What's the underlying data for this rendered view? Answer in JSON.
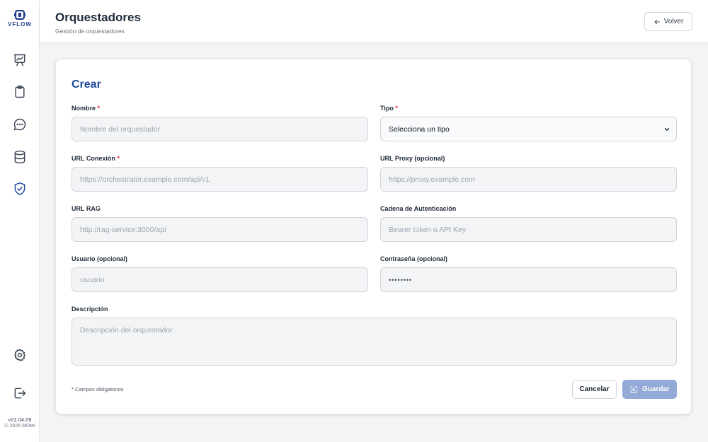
{
  "sidebar": {
    "logo_text": "VFLOW",
    "nav": [
      {
        "icon": "presentation-chart-icon"
      },
      {
        "icon": "clipboard-icon"
      },
      {
        "icon": "chat-bubble-icon"
      },
      {
        "icon": "database-icon"
      },
      {
        "icon": "shield-check-icon",
        "active": true
      }
    ],
    "bottom": [
      {
        "icon": "gear-icon"
      },
      {
        "icon": "logout-icon"
      }
    ],
    "version": "v01.04.09",
    "copyright": "© 2026 MOtel"
  },
  "header": {
    "title": "Orquestadores",
    "subtitle": "Gestión de orquestadores",
    "back_label": "Volver"
  },
  "form": {
    "title": "Crear",
    "fields": {
      "nombre": {
        "label": "Nombre",
        "required_mark": "*",
        "placeholder": "Nombre del orquestador"
      },
      "tipo": {
        "label": "Tipo",
        "required_mark": "*",
        "value": "Selecciona un tipo"
      },
      "url_conexion": {
        "label": "URL Conexión",
        "required_mark": "*",
        "placeholder": "https://orchestrator.example.com/api/v1"
      },
      "url_proxy": {
        "label": "URL Proxy (opcional)",
        "placeholder": "https://proxy.example.com"
      },
      "url_rag": {
        "label": "URL RAG",
        "placeholder": "http://rag-service:3000/api"
      },
      "cadena_auth": {
        "label": "Cadena de Autenticación",
        "placeholder": "Bearer token o API Key"
      },
      "usuario": {
        "label": "Usuario (opcional)",
        "placeholder": "usuario"
      },
      "contrasena": {
        "label": "Contraseña (opcional)",
        "value": "••••••••"
      },
      "descripcion": {
        "label": "Descripción",
        "placeholder": "Descripción del orquestador"
      }
    },
    "required_note": "* Campos obligatorios",
    "cancel_label": "Cancelar",
    "save_label": "Guardar"
  },
  "colors": {
    "accent": "#1e4a9a",
    "required": "#dc2626",
    "save_disabled": "#93a9d6"
  }
}
